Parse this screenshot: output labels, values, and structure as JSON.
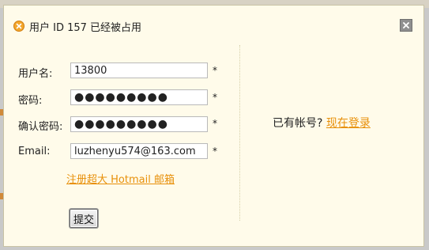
{
  "dialog": {
    "title": "用户 ID 157 已经被占用",
    "error_icon": "error-x-icon",
    "close_icon": "close-x-icon"
  },
  "form": {
    "username": {
      "label": "用户名:",
      "value": "13800",
      "required": "*"
    },
    "password": {
      "label": "密码:",
      "value": "●●●●●●●●●",
      "required": "*"
    },
    "confirm_password": {
      "label": "确认密码:",
      "value": "●●●●●●●●●",
      "required": "*"
    },
    "email": {
      "label": "Email:",
      "value": "luzhenyu574@163.com",
      "required": "*"
    },
    "hotmail_link": "注册超大 Hotmail 邮箱",
    "submit_label": "提交"
  },
  "side": {
    "prompt": "已有帐号?",
    "login_link": "现在登录"
  },
  "colors": {
    "dialog_bg": "#fffbea",
    "link": "#e8900a",
    "error_icon": "#f3a62b"
  }
}
